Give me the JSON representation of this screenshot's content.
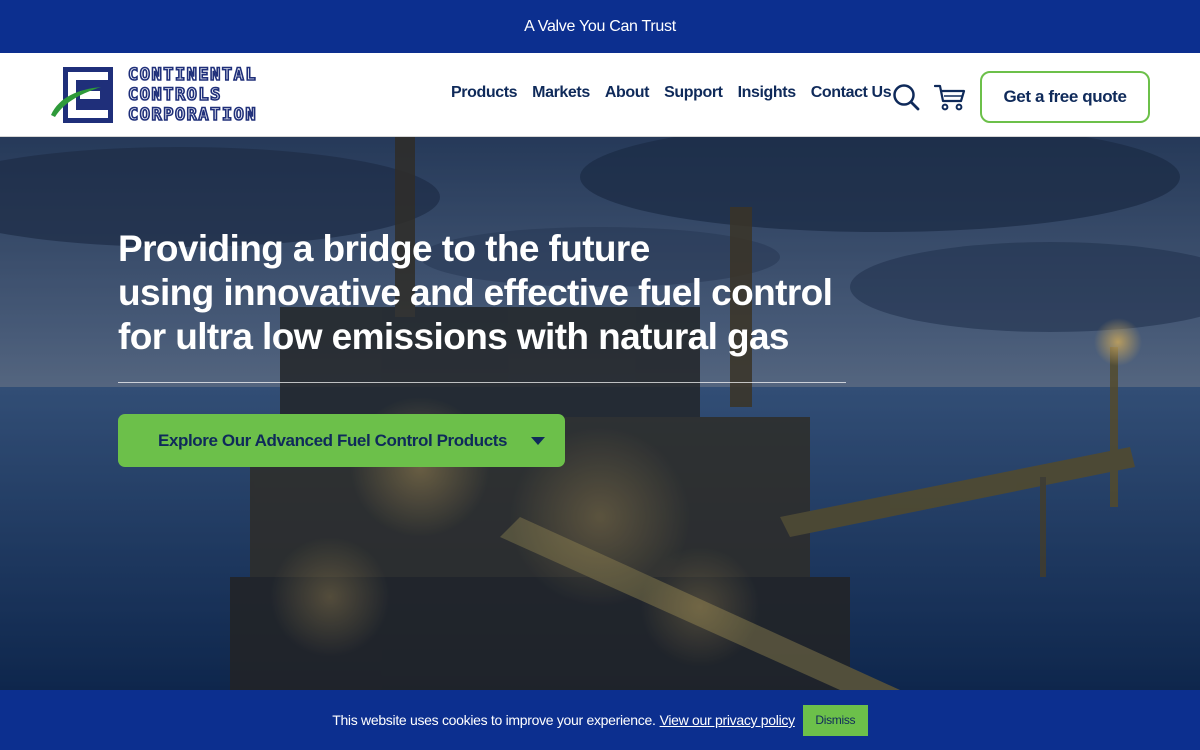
{
  "topbar": {
    "tagline": "A Valve You Can Trust"
  },
  "logo": {
    "lines": [
      "CONTINENTAL",
      "CONTROLS",
      "CORPORATION"
    ]
  },
  "nav": {
    "items": [
      {
        "label": "Products"
      },
      {
        "label": "Markets"
      },
      {
        "label": "About"
      },
      {
        "label": "Support"
      },
      {
        "label": "Insights"
      },
      {
        "label": "Contact Us"
      }
    ],
    "search_icon": "search-icon",
    "cart_icon": "cart-icon",
    "quote_label": "Get a free quote"
  },
  "hero": {
    "title_lines": [
      "Providing a bridge to the future",
      "using innovative and effective fuel control",
      "for ultra low emissions with natural gas"
    ],
    "cta_label": "Explore Our Advanced Fuel Control Products",
    "cta_icon": "chevron-down-icon"
  },
  "cookie": {
    "message": "This website uses cookies to improve your experience.",
    "policy_link": "View our privacy policy",
    "dismiss_label": "Dismiss"
  },
  "colors": {
    "brand_blue": "#0c2f8f",
    "accent_green": "#6cc04a",
    "nav_text": "#0f2a5a"
  }
}
